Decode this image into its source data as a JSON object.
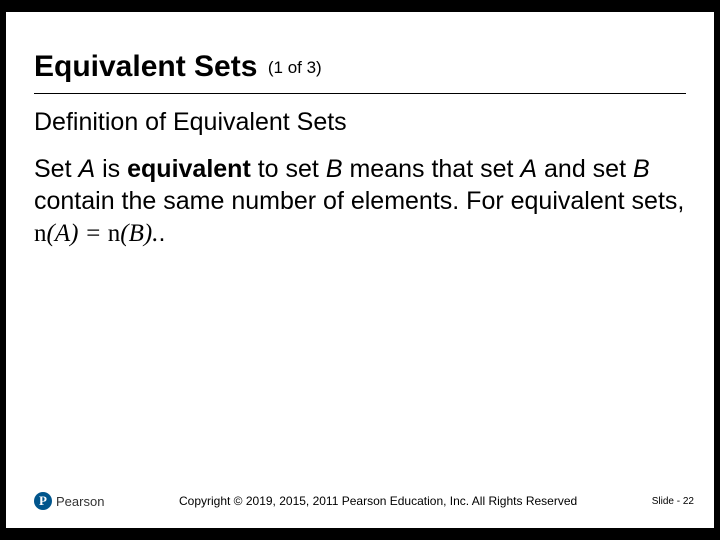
{
  "title": {
    "main": "Equivalent Sets",
    "part": "(1 of 3)"
  },
  "subhead": "Definition of Equivalent Sets",
  "body": {
    "seg1": "Set ",
    "A1": "A",
    "seg2": " is ",
    "bold": "equivalent",
    "seg3": " to set ",
    "B1": "B",
    "seg4": " means that set ",
    "A2": "A",
    "seg5": " and set ",
    "B2": "B",
    "seg6": " contain the same number of elements. For equivalent sets, ",
    "eq": "n(A) = n(B).",
    "period": "."
  },
  "footer": {
    "brand": "Pearson",
    "brand_letter": "P",
    "copyright": "Copyright © 2019, 2015, 2011 Pearson Education, Inc. All Rights Reserved",
    "slide_label": "Slide - ",
    "slide_num": "22"
  }
}
